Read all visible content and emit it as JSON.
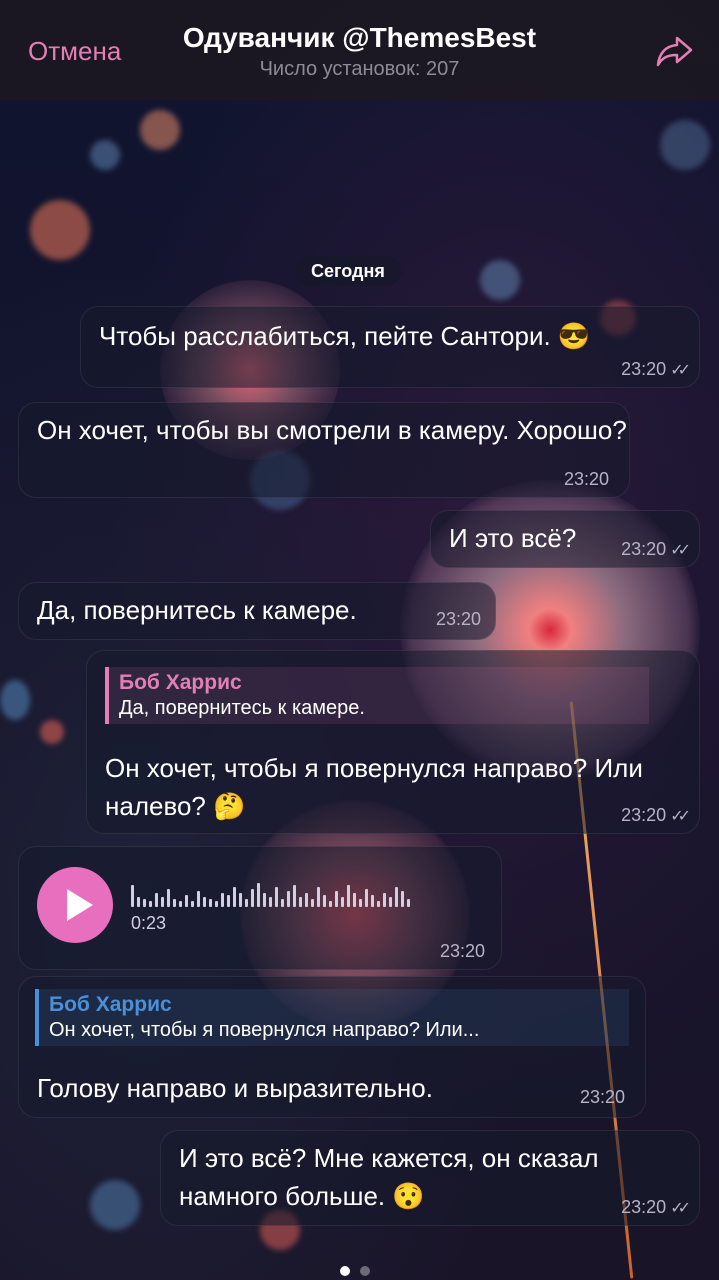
{
  "header": {
    "cancel_label": "Отмена",
    "title": "Одуванчик @ThemesBest",
    "subtitle": "Число установок: 207",
    "share_icon": "share-arrow-icon"
  },
  "date_divider": "Сегодня",
  "messages": [
    {
      "text": "Чтобы расслабиться, пейте Сантори. 😎",
      "time": "23:20",
      "outgoing": true
    },
    {
      "text": "Он хочет, чтобы вы смотрели в камеру. Хорошо?",
      "time": "23:20",
      "outgoing": false
    },
    {
      "text": "И это всё?",
      "time": "23:20",
      "outgoing": true
    },
    {
      "text": "Да, повернитесь к камере.",
      "time": "23:20",
      "outgoing": false
    },
    {
      "reply_name": "Боб Харрис",
      "reply_text": "Да, повернитесь к камере.",
      "text": "Он хочет, чтобы я повернулся направо? Или налево? 🤔",
      "time": "23:20",
      "outgoing": true
    },
    {
      "voice_duration": "0:23",
      "time": "23:20",
      "outgoing": false
    },
    {
      "reply_name": "Боб Харрис",
      "reply_text": "Он хочет, чтобы я повернулся направо? Или...",
      "text": "Голову направо и выразительно.",
      "time": "23:20",
      "outgoing": false
    },
    {
      "text": "И это всё? Мне кажется, он сказал намного больше. 😯",
      "time": "23:20",
      "outgoing": true
    }
  ],
  "colors": {
    "accent": "#e37fb5",
    "play_button": "#e86fbd",
    "reply_outgoing": "#e37fb5",
    "reply_incoming": "#4a90d9"
  },
  "pager": {
    "pages": 2,
    "current": 1
  }
}
